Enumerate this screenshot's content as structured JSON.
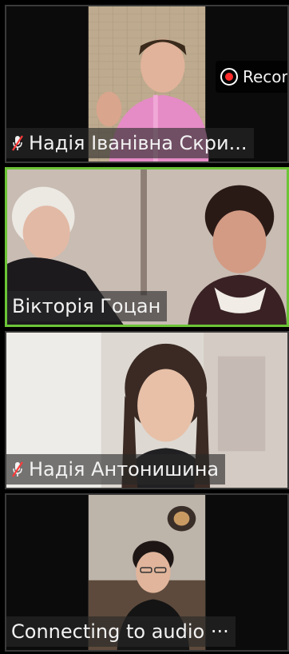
{
  "recording": {
    "label": "Recor"
  },
  "participants": [
    {
      "name": "Надія Іванівна Скри...",
      "muted": true
    },
    {
      "name": "Вікторія Гоцан",
      "muted": false,
      "active_speaker": true
    },
    {
      "name": "Надія Антонишина",
      "muted": true
    },
    {
      "name": "Connecting to audio ···",
      "muted": false
    }
  ],
  "colors": {
    "active_border": "#6cc437",
    "mute_icon": "#ff3a3a",
    "record_dot": "#ff2a2a"
  }
}
